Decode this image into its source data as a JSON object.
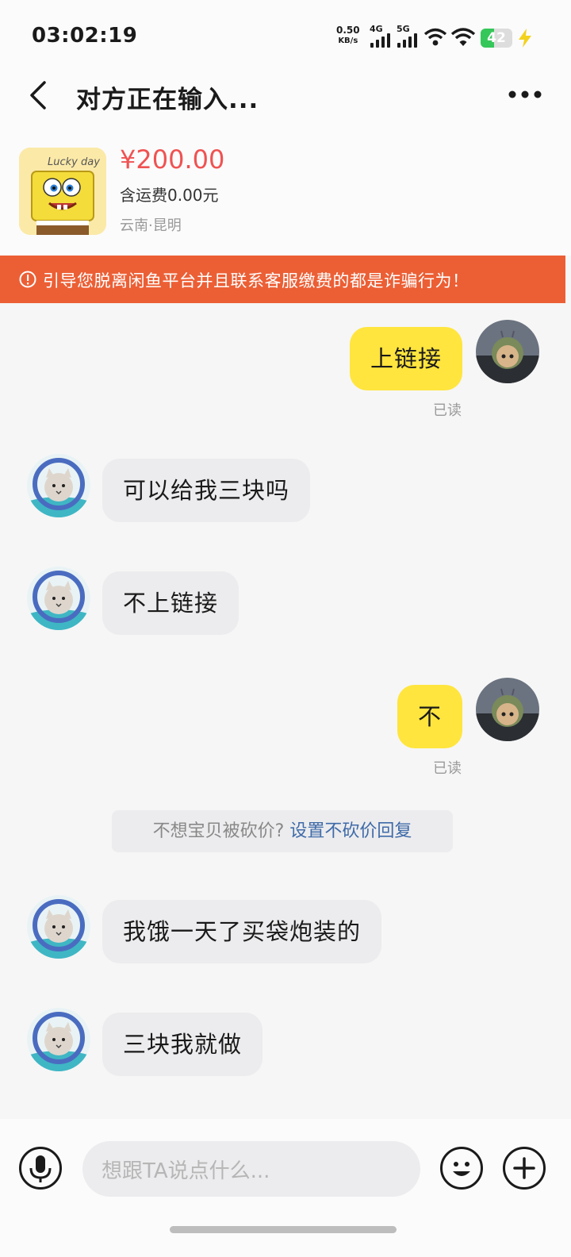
{
  "status_bar": {
    "time": "03:02:19",
    "net_speed": "0.50",
    "net_unit": "KB/s",
    "sig1": "4G",
    "sig2": "5G",
    "battery_level": 42,
    "battery_text": "42"
  },
  "header": {
    "title": "对方正在输入...",
    "product_image_text": "Lucky day",
    "price": "¥200.00",
    "shipping": "含运费0.00元",
    "location": "云南·昆明"
  },
  "warning": {
    "text": "引导您脱离闲鱼平台并且联系客服缴费的都是诈骗行为！"
  },
  "messages": [
    {
      "side": "me",
      "text": "上链接",
      "status": "已读"
    },
    {
      "side": "them",
      "text": "可以给我三块吗"
    },
    {
      "side": "them",
      "text": "不上链接"
    },
    {
      "side": "me",
      "text": "不",
      "status": "已读"
    },
    {
      "side": "them",
      "text": "我饿一天了买袋炮装的"
    },
    {
      "side": "them",
      "text": "三块我就做"
    }
  ],
  "tip": {
    "text": "不想宝贝被砍价?",
    "link": "设置不砍价回复"
  },
  "input": {
    "placeholder": "想跟TA说点什么..."
  },
  "colors": {
    "accent_yellow": "#ffe53e",
    "warning_orange": "#ec5f35",
    "price_red": "#f05252",
    "link_blue": "#3f6aa8"
  }
}
